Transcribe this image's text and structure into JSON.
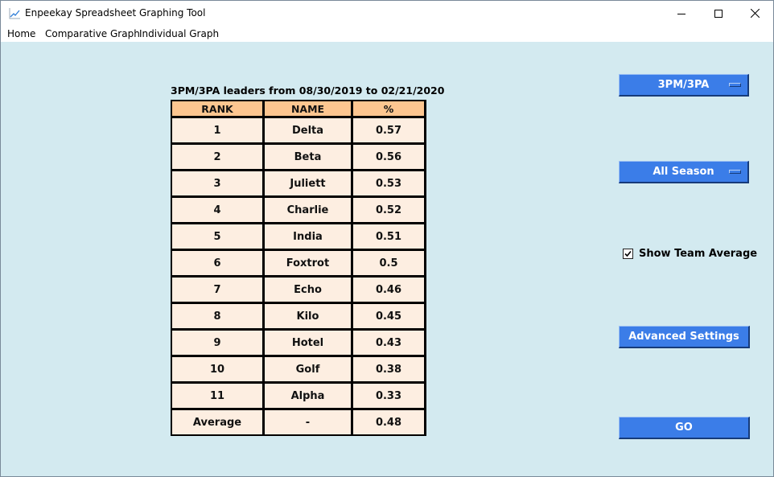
{
  "window": {
    "title": "Enpeekay Spreadsheet Graphing Tool",
    "icon": "line-chart-icon"
  },
  "menu": {
    "items": [
      "Home",
      "Comparative Graph",
      "Individual Graph"
    ]
  },
  "table": {
    "title": "3PM/3PA leaders from 08/30/2019 to 02/21/2020",
    "headers": [
      "RANK",
      "NAME",
      "%"
    ],
    "rows": [
      [
        "1",
        "Delta",
        "0.57"
      ],
      [
        "2",
        "Beta",
        "0.56"
      ],
      [
        "3",
        "Juliett",
        "0.53"
      ],
      [
        "4",
        "Charlie",
        "0.52"
      ],
      [
        "5",
        "India",
        "0.51"
      ],
      [
        "6",
        "Foxtrot",
        "0.5"
      ],
      [
        "7",
        "Echo",
        "0.46"
      ],
      [
        "8",
        "Kilo",
        "0.45"
      ],
      [
        "9",
        "Hotel",
        "0.43"
      ],
      [
        "10",
        "Golf",
        "0.38"
      ],
      [
        "11",
        "Alpha",
        "0.33"
      ],
      [
        "Average",
        "-",
        "0.48"
      ]
    ]
  },
  "controls": {
    "stat_menu": "3PM/3PA",
    "range_menu": "All Season",
    "show_team_average_label": "Show Team Average",
    "show_team_average_checked": true,
    "advanced_label": "Advanced Settings",
    "go_label": "GO"
  },
  "colors": {
    "background": "#d3eaf0",
    "header_cell": "#fdc690",
    "body_cell": "#fdeee1",
    "button": "#3b7de8"
  }
}
